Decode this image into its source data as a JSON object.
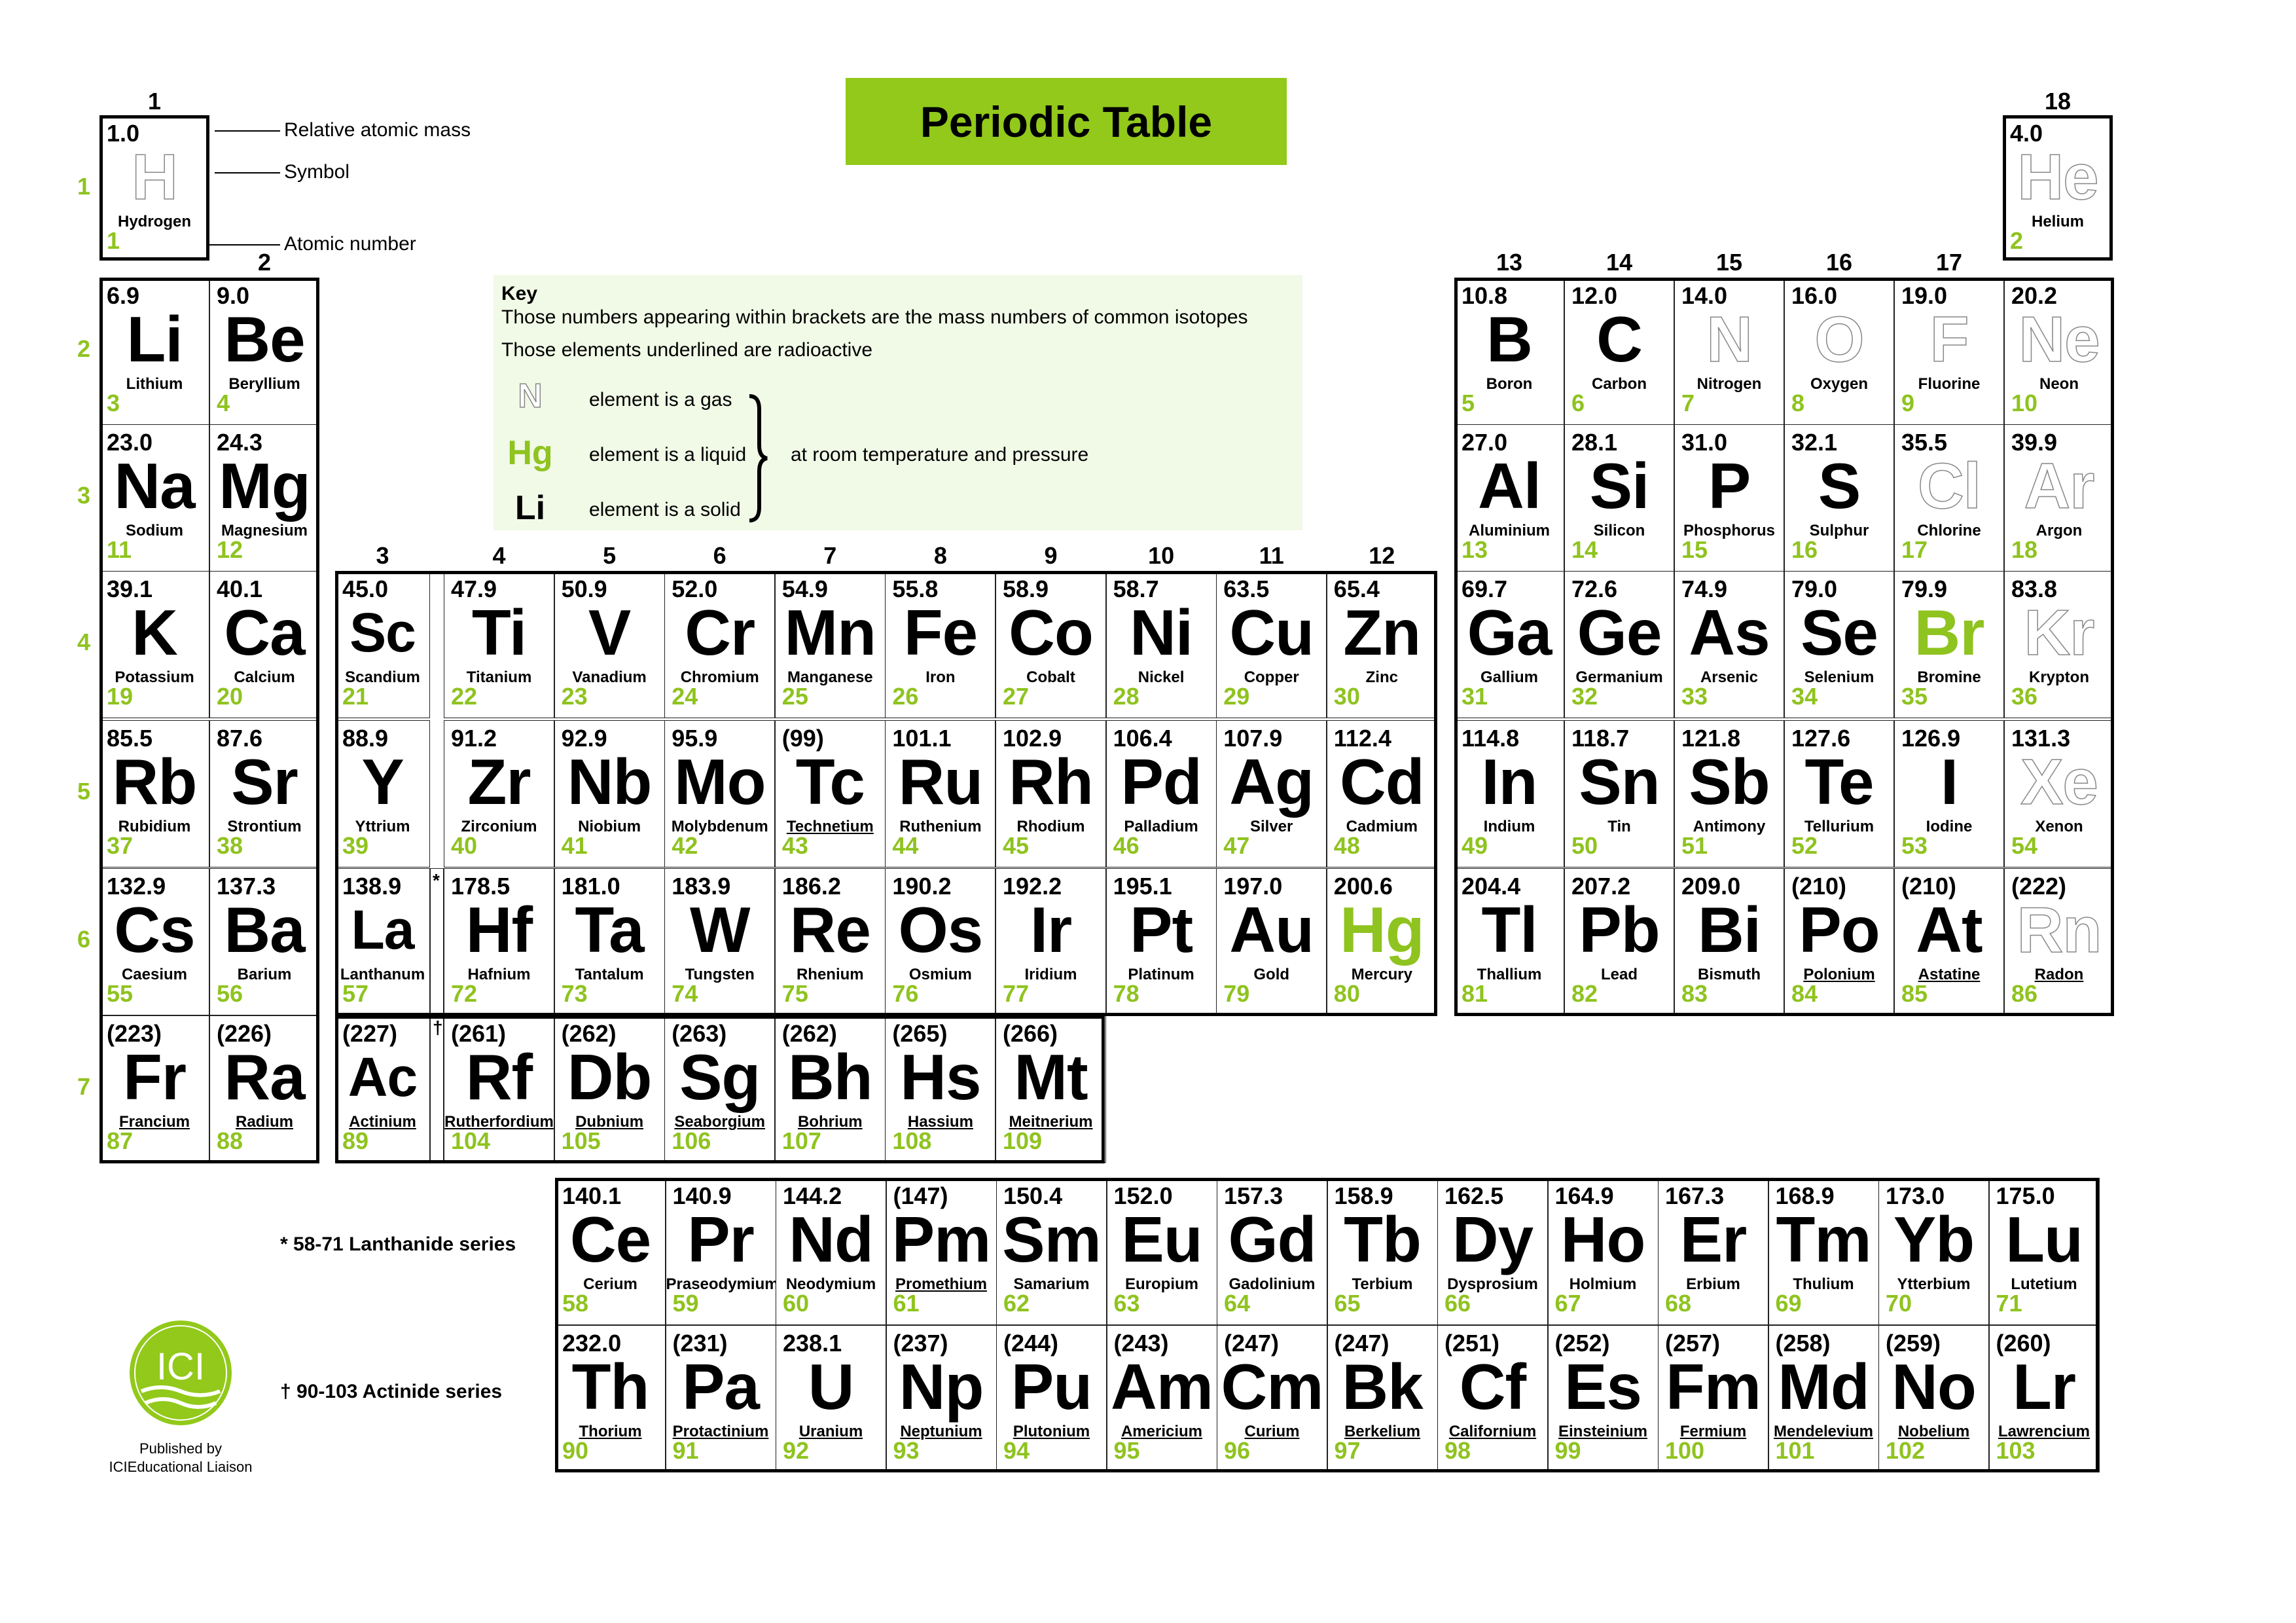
{
  "title": "Periodic Table",
  "legend": {
    "relative_atomic_mass": "Relative atomic mass",
    "symbol": "Symbol",
    "atomic_number": "Atomic number"
  },
  "key": {
    "title": "Key",
    "line1": "Those numbers appearing within brackets are the mass numbers of common isotopes",
    "line2": "Those elements underlined are radioactive",
    "gas_symbol": "N",
    "gas_text": "element is a gas",
    "liquid_symbol": "Hg",
    "liquid_text": "element is a liquid",
    "solid_symbol": "Li",
    "solid_text": "element is a solid",
    "brace_text": "at room temperature and pressure"
  },
  "group_numbers": [
    "1",
    "2",
    "3",
    "4",
    "5",
    "6",
    "7",
    "8",
    "9",
    "10",
    "11",
    "12",
    "13",
    "14",
    "15",
    "16",
    "17",
    "18"
  ],
  "period_numbers": [
    "1",
    "2",
    "3",
    "4",
    "5",
    "6",
    "7"
  ],
  "markers": {
    "lanthanide": "*",
    "actinide": "†"
  },
  "series_labels": {
    "lanthanide": "* 58-71 Lanthanide series",
    "actinide": "† 90-103 Actinide series"
  },
  "publisher": {
    "logo_text": "ICI",
    "line1": "Published by",
    "line2": "ICIEducational Liaison"
  },
  "colors": {
    "accent_green": "#92c91a",
    "atomic_number_green": "#8fc31f",
    "key_background": "#f1f9e7"
  },
  "elements": [
    {
      "z": 1,
      "sym": "H",
      "name": "Hydrogen",
      "mass": "1.0",
      "state": "gas",
      "radio": false,
      "period": 1,
      "group": 1
    },
    {
      "z": 2,
      "sym": "He",
      "name": "Helium",
      "mass": "4.0",
      "state": "gas",
      "radio": false,
      "period": 1,
      "group": 18
    },
    {
      "z": 3,
      "sym": "Li",
      "name": "Lithium",
      "mass": "6.9",
      "state": "solid",
      "radio": false,
      "period": 2,
      "group": 1
    },
    {
      "z": 4,
      "sym": "Be",
      "name": "Beryllium",
      "mass": "9.0",
      "state": "solid",
      "radio": false,
      "period": 2,
      "group": 2
    },
    {
      "z": 5,
      "sym": "B",
      "name": "Boron",
      "mass": "10.8",
      "state": "solid",
      "radio": false,
      "period": 2,
      "group": 13
    },
    {
      "z": 6,
      "sym": "C",
      "name": "Carbon",
      "mass": "12.0",
      "state": "solid",
      "radio": false,
      "period": 2,
      "group": 14
    },
    {
      "z": 7,
      "sym": "N",
      "name": "Nitrogen",
      "mass": "14.0",
      "state": "gas",
      "radio": false,
      "period": 2,
      "group": 15
    },
    {
      "z": 8,
      "sym": "O",
      "name": "Oxygen",
      "mass": "16.0",
      "state": "gas",
      "radio": false,
      "period": 2,
      "group": 16
    },
    {
      "z": 9,
      "sym": "F",
      "name": "Fluorine",
      "mass": "19.0",
      "state": "gas",
      "radio": false,
      "period": 2,
      "group": 17
    },
    {
      "z": 10,
      "sym": "Ne",
      "name": "Neon",
      "mass": "20.2",
      "state": "gas",
      "radio": false,
      "period": 2,
      "group": 18
    },
    {
      "z": 11,
      "sym": "Na",
      "name": "Sodium",
      "mass": "23.0",
      "state": "solid",
      "radio": false,
      "period": 3,
      "group": 1
    },
    {
      "z": 12,
      "sym": "Mg",
      "name": "Magnesium",
      "mass": "24.3",
      "state": "solid",
      "radio": false,
      "period": 3,
      "group": 2
    },
    {
      "z": 13,
      "sym": "Al",
      "name": "Aluminium",
      "mass": "27.0",
      "state": "solid",
      "radio": false,
      "period": 3,
      "group": 13
    },
    {
      "z": 14,
      "sym": "Si",
      "name": "Silicon",
      "mass": "28.1",
      "state": "solid",
      "radio": false,
      "period": 3,
      "group": 14
    },
    {
      "z": 15,
      "sym": "P",
      "name": "Phosphorus",
      "mass": "31.0",
      "state": "solid",
      "radio": false,
      "period": 3,
      "group": 15
    },
    {
      "z": 16,
      "sym": "S",
      "name": "Sulphur",
      "mass": "32.1",
      "state": "solid",
      "radio": false,
      "period": 3,
      "group": 16
    },
    {
      "z": 17,
      "sym": "Cl",
      "name": "Chlorine",
      "mass": "35.5",
      "state": "gas",
      "radio": false,
      "period": 3,
      "group": 17
    },
    {
      "z": 18,
      "sym": "Ar",
      "name": "Argon",
      "mass": "39.9",
      "state": "gas",
      "radio": false,
      "period": 3,
      "group": 18
    },
    {
      "z": 19,
      "sym": "K",
      "name": "Potassium",
      "mass": "39.1",
      "state": "solid",
      "radio": false,
      "period": 4,
      "group": 1
    },
    {
      "z": 20,
      "sym": "Ca",
      "name": "Calcium",
      "mass": "40.1",
      "state": "solid",
      "radio": false,
      "period": 4,
      "group": 2
    },
    {
      "z": 21,
      "sym": "Sc",
      "name": "Scandium",
      "mass": "45.0",
      "state": "solid",
      "radio": false,
      "period": 4,
      "group": 3
    },
    {
      "z": 22,
      "sym": "Ti",
      "name": "Titanium",
      "mass": "47.9",
      "state": "solid",
      "radio": false,
      "period": 4,
      "group": 4
    },
    {
      "z": 23,
      "sym": "V",
      "name": "Vanadium",
      "mass": "50.9",
      "state": "solid",
      "radio": false,
      "period": 4,
      "group": 5
    },
    {
      "z": 24,
      "sym": "Cr",
      "name": "Chromium",
      "mass": "52.0",
      "state": "solid",
      "radio": false,
      "period": 4,
      "group": 6
    },
    {
      "z": 25,
      "sym": "Mn",
      "name": "Manganese",
      "mass": "54.9",
      "state": "solid",
      "radio": false,
      "period": 4,
      "group": 7
    },
    {
      "z": 26,
      "sym": "Fe",
      "name": "Iron",
      "mass": "55.8",
      "state": "solid",
      "radio": false,
      "period": 4,
      "group": 8
    },
    {
      "z": 27,
      "sym": "Co",
      "name": "Cobalt",
      "mass": "58.9",
      "state": "solid",
      "radio": false,
      "period": 4,
      "group": 9
    },
    {
      "z": 28,
      "sym": "Ni",
      "name": "Nickel",
      "mass": "58.7",
      "state": "solid",
      "radio": false,
      "period": 4,
      "group": 10
    },
    {
      "z": 29,
      "sym": "Cu",
      "name": "Copper",
      "mass": "63.5",
      "state": "solid",
      "radio": false,
      "period": 4,
      "group": 11
    },
    {
      "z": 30,
      "sym": "Zn",
      "name": "Zinc",
      "mass": "65.4",
      "state": "solid",
      "radio": false,
      "period": 4,
      "group": 12
    },
    {
      "z": 31,
      "sym": "Ga",
      "name": "Gallium",
      "mass": "69.7",
      "state": "solid",
      "radio": false,
      "period": 4,
      "group": 13
    },
    {
      "z": 32,
      "sym": "Ge",
      "name": "Germanium",
      "mass": "72.6",
      "state": "solid",
      "radio": false,
      "period": 4,
      "group": 14
    },
    {
      "z": 33,
      "sym": "As",
      "name": "Arsenic",
      "mass": "74.9",
      "state": "solid",
      "radio": false,
      "period": 4,
      "group": 15
    },
    {
      "z": 34,
      "sym": "Se",
      "name": "Selenium",
      "mass": "79.0",
      "state": "solid",
      "radio": false,
      "period": 4,
      "group": 16
    },
    {
      "z": 35,
      "sym": "Br",
      "name": "Bromine",
      "mass": "79.9",
      "state": "liquid",
      "radio": false,
      "period": 4,
      "group": 17
    },
    {
      "z": 36,
      "sym": "Kr",
      "name": "Krypton",
      "mass": "83.8",
      "state": "gas",
      "radio": false,
      "period": 4,
      "group": 18
    },
    {
      "z": 37,
      "sym": "Rb",
      "name": "Rubidium",
      "mass": "85.5",
      "state": "solid",
      "radio": false,
      "period": 5,
      "group": 1
    },
    {
      "z": 38,
      "sym": "Sr",
      "name": "Strontium",
      "mass": "87.6",
      "state": "solid",
      "radio": false,
      "period": 5,
      "group": 2
    },
    {
      "z": 39,
      "sym": "Y",
      "name": "Yttrium",
      "mass": "88.9",
      "state": "solid",
      "radio": false,
      "period": 5,
      "group": 3
    },
    {
      "z": 40,
      "sym": "Zr",
      "name": "Zirconium",
      "mass": "91.2",
      "state": "solid",
      "radio": false,
      "period": 5,
      "group": 4
    },
    {
      "z": 41,
      "sym": "Nb",
      "name": "Niobium",
      "mass": "92.9",
      "state": "solid",
      "radio": false,
      "period": 5,
      "group": 5
    },
    {
      "z": 42,
      "sym": "Mo",
      "name": "Molybdenum",
      "mass": "95.9",
      "state": "solid",
      "radio": false,
      "period": 5,
      "group": 6
    },
    {
      "z": 43,
      "sym": "Tc",
      "name": "Technetium",
      "mass": "(99)",
      "state": "solid",
      "radio": true,
      "period": 5,
      "group": 7
    },
    {
      "z": 44,
      "sym": "Ru",
      "name": "Ruthenium",
      "mass": "101.1",
      "state": "solid",
      "radio": false,
      "period": 5,
      "group": 8
    },
    {
      "z": 45,
      "sym": "Rh",
      "name": "Rhodium",
      "mass": "102.9",
      "state": "solid",
      "radio": false,
      "period": 5,
      "group": 9
    },
    {
      "z": 46,
      "sym": "Pd",
      "name": "Palladium",
      "mass": "106.4",
      "state": "solid",
      "radio": false,
      "period": 5,
      "group": 10
    },
    {
      "z": 47,
      "sym": "Ag",
      "name": "Silver",
      "mass": "107.9",
      "state": "solid",
      "radio": false,
      "period": 5,
      "group": 11
    },
    {
      "z": 48,
      "sym": "Cd",
      "name": "Cadmium",
      "mass": "112.4",
      "state": "solid",
      "radio": false,
      "period": 5,
      "group": 12
    },
    {
      "z": 49,
      "sym": "In",
      "name": "Indium",
      "mass": "114.8",
      "state": "solid",
      "radio": false,
      "period": 5,
      "group": 13
    },
    {
      "z": 50,
      "sym": "Sn",
      "name": "Tin",
      "mass": "118.7",
      "state": "solid",
      "radio": false,
      "period": 5,
      "group": 14
    },
    {
      "z": 51,
      "sym": "Sb",
      "name": "Antimony",
      "mass": "121.8",
      "state": "solid",
      "radio": false,
      "period": 5,
      "group": 15
    },
    {
      "z": 52,
      "sym": "Te",
      "name": "Tellurium",
      "mass": "127.6",
      "state": "solid",
      "radio": false,
      "period": 5,
      "group": 16
    },
    {
      "z": 53,
      "sym": "I",
      "name": "Iodine",
      "mass": "126.9",
      "state": "solid",
      "radio": false,
      "period": 5,
      "group": 17
    },
    {
      "z": 54,
      "sym": "Xe",
      "name": "Xenon",
      "mass": "131.3",
      "state": "gas",
      "radio": false,
      "period": 5,
      "group": 18
    },
    {
      "z": 55,
      "sym": "Cs",
      "name": "Caesium",
      "mass": "132.9",
      "state": "solid",
      "radio": false,
      "period": 6,
      "group": 1
    },
    {
      "z": 56,
      "sym": "Ba",
      "name": "Barium",
      "mass": "137.3",
      "state": "solid",
      "radio": false,
      "period": 6,
      "group": 2
    },
    {
      "z": 57,
      "sym": "La",
      "name": "Lanthanum",
      "mass": "138.9",
      "state": "solid",
      "radio": false,
      "period": 6,
      "group": 3
    },
    {
      "z": 72,
      "sym": "Hf",
      "name": "Hafnium",
      "mass": "178.5",
      "state": "solid",
      "radio": false,
      "period": 6,
      "group": 4
    },
    {
      "z": 73,
      "sym": "Ta",
      "name": "Tantalum",
      "mass": "181.0",
      "state": "solid",
      "radio": false,
      "period": 6,
      "group": 5
    },
    {
      "z": 74,
      "sym": "W",
      "name": "Tungsten",
      "mass": "183.9",
      "state": "solid",
      "radio": false,
      "period": 6,
      "group": 6
    },
    {
      "z": 75,
      "sym": "Re",
      "name": "Rhenium",
      "mass": "186.2",
      "state": "solid",
      "radio": false,
      "period": 6,
      "group": 7
    },
    {
      "z": 76,
      "sym": "Os",
      "name": "Osmium",
      "mass": "190.2",
      "state": "solid",
      "radio": false,
      "period": 6,
      "group": 8
    },
    {
      "z": 77,
      "sym": "Ir",
      "name": "Iridium",
      "mass": "192.2",
      "state": "solid",
      "radio": false,
      "period": 6,
      "group": 9
    },
    {
      "z": 78,
      "sym": "Pt",
      "name": "Platinum",
      "mass": "195.1",
      "state": "solid",
      "radio": false,
      "period": 6,
      "group": 10
    },
    {
      "z": 79,
      "sym": "Au",
      "name": "Gold",
      "mass": "197.0",
      "state": "solid",
      "radio": false,
      "period": 6,
      "group": 11
    },
    {
      "z": 80,
      "sym": "Hg",
      "name": "Mercury",
      "mass": "200.6",
      "state": "liquid",
      "radio": false,
      "period": 6,
      "group": 12
    },
    {
      "z": 81,
      "sym": "Tl",
      "name": "Thallium",
      "mass": "204.4",
      "state": "solid",
      "radio": false,
      "period": 6,
      "group": 13
    },
    {
      "z": 82,
      "sym": "Pb",
      "name": "Lead",
      "mass": "207.2",
      "state": "solid",
      "radio": false,
      "period": 6,
      "group": 14
    },
    {
      "z": 83,
      "sym": "Bi",
      "name": "Bismuth",
      "mass": "209.0",
      "state": "solid",
      "radio": false,
      "period": 6,
      "group": 15
    },
    {
      "z": 84,
      "sym": "Po",
      "name": "Polonium",
      "mass": "(210)",
      "state": "solid",
      "radio": true,
      "period": 6,
      "group": 16
    },
    {
      "z": 85,
      "sym": "At",
      "name": "Astatine",
      "mass": "(210)",
      "state": "solid",
      "radio": true,
      "period": 6,
      "group": 17
    },
    {
      "z": 86,
      "sym": "Rn",
      "name": "Radon",
      "mass": "(222)",
      "state": "gas",
      "radio": true,
      "period": 6,
      "group": 18
    },
    {
      "z": 87,
      "sym": "Fr",
      "name": "Francium",
      "mass": "(223)",
      "state": "solid",
      "radio": true,
      "period": 7,
      "group": 1
    },
    {
      "z": 88,
      "sym": "Ra",
      "name": "Radium",
      "mass": "(226)",
      "state": "solid",
      "radio": true,
      "period": 7,
      "group": 2
    },
    {
      "z": 89,
      "sym": "Ac",
      "name": "Actinium",
      "mass": "(227)",
      "state": "solid",
      "radio": true,
      "period": 7,
      "group": 3
    },
    {
      "z": 104,
      "sym": "Rf",
      "name": "Rutherfordium",
      "mass": "(261)",
      "state": "solid",
      "radio": true,
      "period": 7,
      "group": 4
    },
    {
      "z": 105,
      "sym": "Db",
      "name": "Dubnium",
      "mass": "(262)",
      "state": "solid",
      "radio": true,
      "period": 7,
      "group": 5
    },
    {
      "z": 106,
      "sym": "Sg",
      "name": "Seaborgium",
      "mass": "(263)",
      "state": "solid",
      "radio": true,
      "period": 7,
      "group": 6
    },
    {
      "z": 107,
      "sym": "Bh",
      "name": "Bohrium",
      "mass": "(262)",
      "state": "solid",
      "radio": true,
      "period": 7,
      "group": 7
    },
    {
      "z": 108,
      "sym": "Hs",
      "name": "Hassium",
      "mass": "(265)",
      "state": "solid",
      "radio": true,
      "period": 7,
      "group": 8
    },
    {
      "z": 109,
      "sym": "Mt",
      "name": "Meitnerium",
      "mass": "(266)",
      "state": "solid",
      "radio": true,
      "period": 7,
      "group": 9
    }
  ],
  "lanthanides": [
    {
      "z": 58,
      "sym": "Ce",
      "name": "Cerium",
      "mass": "140.1",
      "state": "solid",
      "radio": false
    },
    {
      "z": 59,
      "sym": "Pr",
      "name": "Praseodymium",
      "mass": "140.9",
      "state": "solid",
      "radio": false
    },
    {
      "z": 60,
      "sym": "Nd",
      "name": "Neodymium",
      "mass": "144.2",
      "state": "solid",
      "radio": false
    },
    {
      "z": 61,
      "sym": "Pm",
      "name": "Promethium",
      "mass": "(147)",
      "state": "solid",
      "radio": true
    },
    {
      "z": 62,
      "sym": "Sm",
      "name": "Samarium",
      "mass": "150.4",
      "state": "solid",
      "radio": false
    },
    {
      "z": 63,
      "sym": "Eu",
      "name": "Europium",
      "mass": "152.0",
      "state": "solid",
      "radio": false
    },
    {
      "z": 64,
      "sym": "Gd",
      "name": "Gadolinium",
      "mass": "157.3",
      "state": "solid",
      "radio": false
    },
    {
      "z": 65,
      "sym": "Tb",
      "name": "Terbium",
      "mass": "158.9",
      "state": "solid",
      "radio": false
    },
    {
      "z": 66,
      "sym": "Dy",
      "name": "Dysprosium",
      "mass": "162.5",
      "state": "solid",
      "radio": false
    },
    {
      "z": 67,
      "sym": "Ho",
      "name": "Holmium",
      "mass": "164.9",
      "state": "solid",
      "radio": false
    },
    {
      "z": 68,
      "sym": "Er",
      "name": "Erbium",
      "mass": "167.3",
      "state": "solid",
      "radio": false
    },
    {
      "z": 69,
      "sym": "Tm",
      "name": "Thulium",
      "mass": "168.9",
      "state": "solid",
      "radio": false
    },
    {
      "z": 70,
      "sym": "Yb",
      "name": "Ytterbium",
      "mass": "173.0",
      "state": "solid",
      "radio": false
    },
    {
      "z": 71,
      "sym": "Lu",
      "name": "Lutetium",
      "mass": "175.0",
      "state": "solid",
      "radio": false
    }
  ],
  "actinides": [
    {
      "z": 90,
      "sym": "Th",
      "name": "Thorium",
      "mass": "232.0",
      "state": "solid",
      "radio": true
    },
    {
      "z": 91,
      "sym": "Pa",
      "name": "Protactinium",
      "mass": "(231)",
      "state": "solid",
      "radio": true
    },
    {
      "z": 92,
      "sym": "U",
      "name": "Uranium",
      "mass": "238.1",
      "state": "solid",
      "radio": true
    },
    {
      "z": 93,
      "sym": "Np",
      "name": "Neptunium",
      "mass": "(237)",
      "state": "solid",
      "radio": true
    },
    {
      "z": 94,
      "sym": "Pu",
      "name": "Plutonium",
      "mass": "(244)",
      "state": "solid",
      "radio": true
    },
    {
      "z": 95,
      "sym": "Am",
      "name": "Americium",
      "mass": "(243)",
      "state": "solid",
      "radio": true
    },
    {
      "z": 96,
      "sym": "Cm",
      "name": "Curium",
      "mass": "(247)",
      "state": "solid",
      "radio": true
    },
    {
      "z": 97,
      "sym": "Bk",
      "name": "Berkelium",
      "mass": "(247)",
      "state": "solid",
      "radio": true
    },
    {
      "z": 98,
      "sym": "Cf",
      "name": "Californium",
      "mass": "(251)",
      "state": "solid",
      "radio": true
    },
    {
      "z": 99,
      "sym": "Es",
      "name": "Einsteinium",
      "mass": "(252)",
      "state": "solid",
      "radio": true
    },
    {
      "z": 100,
      "sym": "Fm",
      "name": "Fermium",
      "mass": "(257)",
      "state": "solid",
      "radio": true
    },
    {
      "z": 101,
      "sym": "Md",
      "name": "Mendelevium",
      "mass": "(258)",
      "state": "solid",
      "radio": true
    },
    {
      "z": 102,
      "sym": "No",
      "name": "Nobelium",
      "mass": "(259)",
      "state": "solid",
      "radio": true
    },
    {
      "z": 103,
      "sym": "Lr",
      "name": "Lawrencium",
      "mass": "(260)",
      "state": "solid",
      "radio": true
    }
  ]
}
